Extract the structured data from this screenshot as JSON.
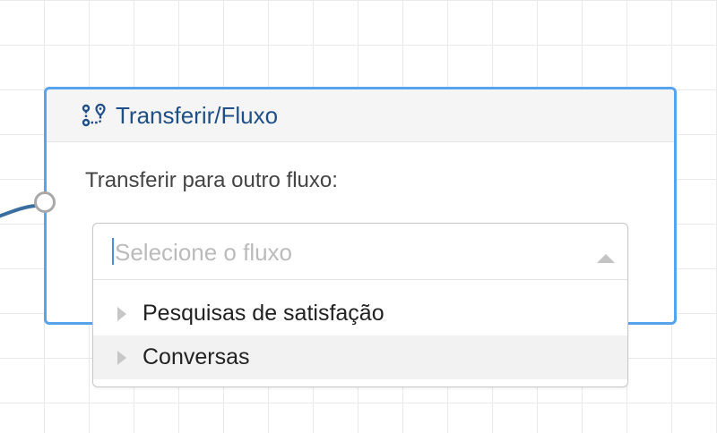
{
  "node": {
    "title": "Transferir/Fluxo",
    "icon": "flow-transfer-icon",
    "prompt_label": "Transferir para outro fluxo:"
  },
  "select": {
    "placeholder": "Selecione o fluxo",
    "options": [
      {
        "label": "Pesquisas de satisfação"
      },
      {
        "label": "Conversas"
      }
    ]
  },
  "colors": {
    "node_border": "#58a3ee",
    "title": "#1f4f86",
    "connector": "#3a6e9e",
    "hover_row": "#f2f2f2"
  }
}
